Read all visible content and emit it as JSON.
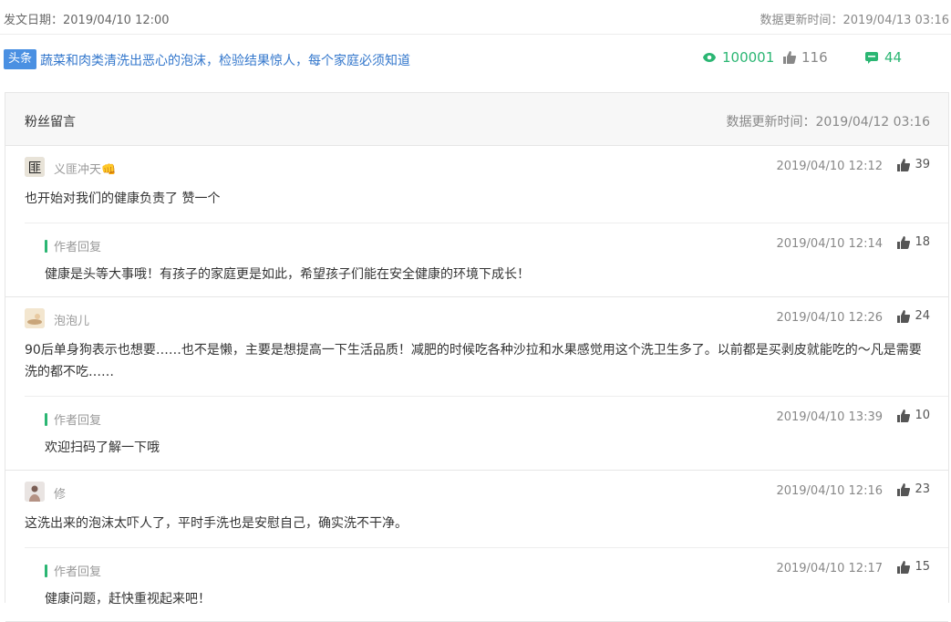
{
  "top": {
    "publish_label": "发文日期：",
    "publish_date": "2019/04/10 12:00",
    "update_label": "数据更新时间：",
    "update_date": "2019/04/13 03:16"
  },
  "article": {
    "tag": "头条",
    "title": "蔬菜和肉类清洗出恶心的泡沫，检验结果惊人，每个家庭必须知道",
    "views": "100001",
    "likes": "116",
    "comments": "44"
  },
  "panel": {
    "title": "粉丝留言",
    "updated": "数据更新时间：2019/04/12 03:16"
  },
  "comments": [
    {
      "user": "义匪冲天👊",
      "time": "2019/04/10 12:12",
      "likes": "39",
      "text": "也开始对我们的健康负责了 赞一个",
      "reply": {
        "label": "作者回复",
        "time": "2019/04/10 12:14",
        "likes": "18",
        "text": "健康是头等大事哦！有孩子的家庭更是如此，希望孩子们能在安全健康的环境下成长！"
      }
    },
    {
      "user": "泡泡儿",
      "time": "2019/04/10 12:26",
      "likes": "24",
      "text": "90后单身狗表示也想要……也不是懒，主要是想提高一下生活品质！减肥的时候吃各种沙拉和水果感觉用这个洗卫生多了。以前都是买剥皮就能吃的～凡是需要洗的都不吃……",
      "reply": {
        "label": "作者回复",
        "time": "2019/04/10 13:39",
        "likes": "10",
        "text": "欢迎扫码了解一下哦"
      }
    },
    {
      "user": "修",
      "time": "2019/04/10 12:16",
      "likes": "23",
      "text": "这洗出来的泡沫太吓人了，平时手洗也是安慰自己，确实洗不干净。",
      "reply": {
        "label": "作者回复",
        "time": "2019/04/10 12:17",
        "likes": "15",
        "text": "健康问题，赶快重视起来吧！"
      }
    }
  ],
  "colors": {
    "accent_green": "#2bb673",
    "link_blue": "#3377cc",
    "tag_blue": "#4a90e2"
  }
}
